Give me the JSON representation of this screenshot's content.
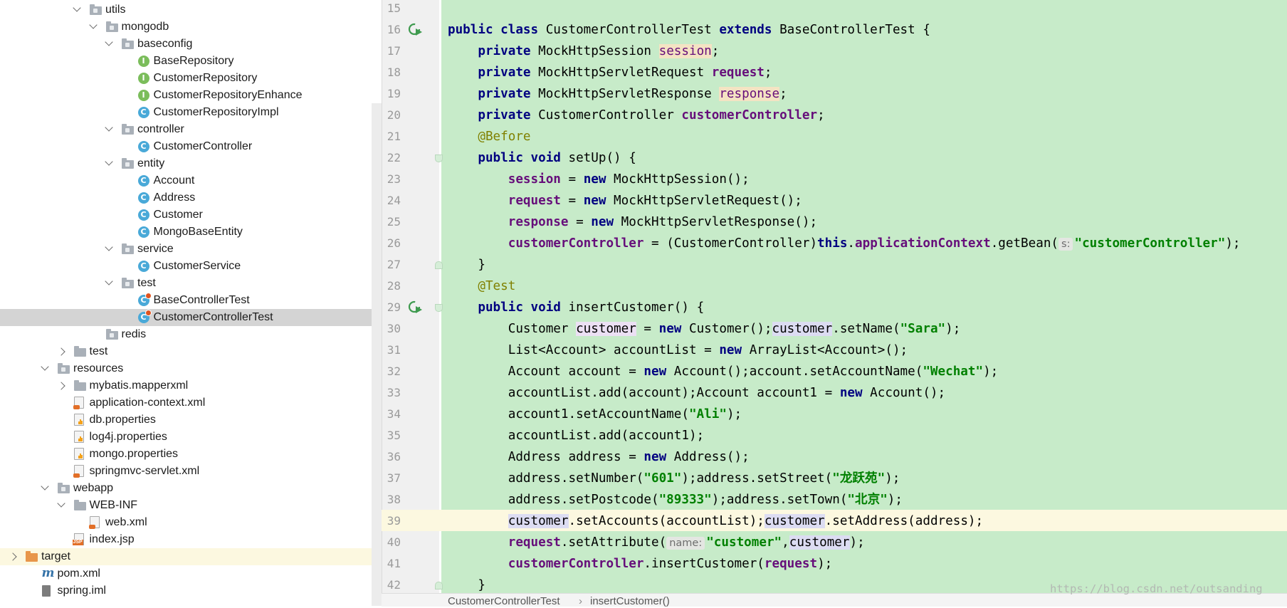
{
  "project_tree": {
    "items": [
      {
        "label": "utils",
        "icon": "folder-dot-icon",
        "chevron": "down",
        "depth": 4
      },
      {
        "label": "mongodb",
        "icon": "folder-dot-icon",
        "chevron": "down",
        "depth": 5
      },
      {
        "label": "baseconfig",
        "icon": "folder-dot-icon",
        "chevron": "down",
        "depth": 6
      },
      {
        "label": "BaseRepository",
        "icon": "interface-icon",
        "chevron": "none",
        "depth": 7
      },
      {
        "label": "CustomerRepository",
        "icon": "interface-icon",
        "chevron": "none",
        "depth": 7
      },
      {
        "label": "CustomerRepositoryEnhance",
        "icon": "interface-icon",
        "chevron": "none",
        "depth": 7
      },
      {
        "label": "CustomerRepositoryImpl",
        "icon": "class-icon",
        "chevron": "none",
        "depth": 7
      },
      {
        "label": "controller",
        "icon": "folder-dot-icon",
        "chevron": "down",
        "depth": 6
      },
      {
        "label": "CustomerController",
        "icon": "class-icon",
        "chevron": "none",
        "depth": 7
      },
      {
        "label": "entity",
        "icon": "folder-dot-icon",
        "chevron": "down",
        "depth": 6
      },
      {
        "label": "Account",
        "icon": "class-icon",
        "chevron": "none",
        "depth": 7
      },
      {
        "label": "Address",
        "icon": "class-icon",
        "chevron": "none",
        "depth": 7
      },
      {
        "label": "Customer",
        "icon": "class-icon",
        "chevron": "none",
        "depth": 7
      },
      {
        "label": "MongoBaseEntity",
        "icon": "class-icon",
        "chevron": "none",
        "depth": 7
      },
      {
        "label": "service",
        "icon": "folder-dot-icon",
        "chevron": "down",
        "depth": 6
      },
      {
        "label": "CustomerService",
        "icon": "class-icon",
        "chevron": "none",
        "depth": 7
      },
      {
        "label": "test",
        "icon": "folder-dot-icon",
        "chevron": "down",
        "depth": 6
      },
      {
        "label": "BaseControllerTest",
        "icon": "test-class-icon",
        "chevron": "none",
        "depth": 7
      },
      {
        "label": "CustomerControllerTest",
        "icon": "test-class-icon",
        "chevron": "none",
        "depth": 7,
        "selected": true
      },
      {
        "label": "redis",
        "icon": "folder-dot-icon",
        "chevron": "none",
        "depth": 5
      },
      {
        "label": "test",
        "icon": "folder-icon",
        "chevron": "right",
        "depth": 3
      },
      {
        "label": "resources",
        "icon": "resources-folder-icon",
        "chevron": "down",
        "depth": 2
      },
      {
        "label": "mybatis.mapperxml",
        "icon": "folder-icon",
        "chevron": "right",
        "depth": 3
      },
      {
        "label": "application-context.xml",
        "icon": "spring-xml-icon",
        "chevron": "none",
        "depth": 3
      },
      {
        "label": "db.properties",
        "icon": "properties-icon",
        "chevron": "none",
        "depth": 3
      },
      {
        "label": "log4j.properties",
        "icon": "properties-icon",
        "chevron": "none",
        "depth": 3
      },
      {
        "label": "mongo.properties",
        "icon": "properties-icon",
        "chevron": "none",
        "depth": 3
      },
      {
        "label": "springmvc-servlet.xml",
        "icon": "spring-xml-icon",
        "chevron": "none",
        "depth": 3
      },
      {
        "label": "webapp",
        "icon": "web-folder-icon",
        "chevron": "down",
        "depth": 2
      },
      {
        "label": "WEB-INF",
        "icon": "folder-icon",
        "chevron": "down",
        "depth": 3
      },
      {
        "label": "web.xml",
        "icon": "web-xml-icon",
        "chevron": "none",
        "depth": 4
      },
      {
        "label": "index.jsp",
        "icon": "jsp-icon",
        "chevron": "none",
        "depth": 3
      },
      {
        "label": "target",
        "icon": "excluded-folder-icon",
        "chevron": "right",
        "depth": 0,
        "highlight": true
      },
      {
        "label": "pom.xml",
        "icon": "maven-icon",
        "chevron": "none",
        "depth": 1
      },
      {
        "label": "spring.iml",
        "icon": "iml-icon",
        "chevron": "none",
        "depth": 1
      }
    ]
  },
  "editor": {
    "lines": [
      {
        "num": "15",
        "html": ""
      },
      {
        "num": "16",
        "run": true,
        "html": "<span class='kw'>public class</span> CustomerControllerTest <span class='kw'>extends</span> BaseControllerTest {"
      },
      {
        "num": "17",
        "html": "    <span class='kw'>private</span> MockHttpSession <span class='fld hl-write' style='font-weight:normal;color:#660e7a'>session</span>;"
      },
      {
        "num": "18",
        "html": "    <span class='kw'>private</span> MockHttpServletRequest <span class='fld'>request</span>;"
      },
      {
        "num": "19",
        "html": "    <span class='kw'>private</span> MockHttpServletResponse <span class='fld hl-write' style='font-weight:normal;color:#660e7a'>response</span>;"
      },
      {
        "num": "20",
        "html": "    <span class='kw'>private</span> CustomerController <span class='fld'>customerController</span>;"
      },
      {
        "num": "21",
        "html": "    <span class='ann'>@Before</span>"
      },
      {
        "num": "22",
        "fold": "open",
        "html": "    <span class='kw'>public void</span> setUp() {"
      },
      {
        "num": "23",
        "html": "        <span class='fld'>session</span> = <span class='kw'>new</span> MockHttpSession();"
      },
      {
        "num": "24",
        "html": "        <span class='fld'>request</span> = <span class='kw'>new</span> MockHttpServletRequest();"
      },
      {
        "num": "25",
        "html": "        <span class='fld'>response</span> = <span class='kw'>new</span> MockHttpServletResponse();"
      },
      {
        "num": "26",
        "html": "        <span class='fld'>customerController</span> = (CustomerController)<span class='kw'>this</span>.<span class='fld'>applicationContext</span>.getBean(<span class='hint'>s:</span><span class='str'>\"customerController\"</span>);"
      },
      {
        "num": "27",
        "fold": "close",
        "html": "    }"
      },
      {
        "num": "28",
        "html": "    <span class='ann'>@Test</span>"
      },
      {
        "num": "29",
        "run": true,
        "fold": "open",
        "html": "    <span class='kw'>public void</span> insertCustomer() {"
      },
      {
        "num": "30",
        "html": "        Customer <span class='hl-sel'>customer</span> = <span class='kw'>new</span> Customer();<span class='hl-ref'>customer</span>.setName(<span class='str'>\"Sara\"</span>);"
      },
      {
        "num": "31",
        "html": "        List&lt;Account&gt; accountList = <span class='kw'>new</span> ArrayList&lt;Account&gt;();"
      },
      {
        "num": "32",
        "html": "        Account account = <span class='kw'>new</span> Account();account.setAccountName(<span class='str'>\"Wechat\"</span>);"
      },
      {
        "num": "33",
        "html": "        accountList.add(account);Account account1 = <span class='kw'>new</span> Account();"
      },
      {
        "num": "34",
        "html": "        account1.setAccountName(<span class='str'>\"Ali\"</span>);"
      },
      {
        "num": "35",
        "html": "        accountList.add(account1);"
      },
      {
        "num": "36",
        "html": "        Address address = <span class='kw'>new</span> Address();"
      },
      {
        "num": "37",
        "html": "        address.setNumber(<span class='str'>\"601\"</span>);address.setStreet(<span class='str'>\"龙跃苑\"</span>);"
      },
      {
        "num": "38",
        "html": "        address.setPostcode(<span class='str'>\"89333\"</span>);address.setTown(<span class='str'>\"北京\"</span>);"
      },
      {
        "num": "39",
        "current": true,
        "html": "        <span class='hl-ref'>customer</span>.setAccounts(accountList);<span class='hl-ref'>customer</span>.setAddress(address);"
      },
      {
        "num": "40",
        "html": "        <span class='fld'>request</span>.setAttribute(<span class='hint'>name:</span><span class='str'>\"customer\"</span>,<span class='hl-ref'>customer</span>);"
      },
      {
        "num": "41",
        "html": "        <span class='fld'>customerController</span>.insertCustomer(<span class='fld'>request</span>);"
      },
      {
        "num": "42",
        "fold": "close",
        "html": "    }"
      }
    ]
  },
  "breadcrumb": {
    "class_name": "CustomerControllerTest",
    "separator": "›",
    "method_name": "insertCustomer()"
  },
  "watermark": "https://blog.csdn.net/outsanding",
  "colors": {
    "code_background": "#c7ebc9",
    "keyword": "#000080",
    "field": "#660e7a",
    "string": "#008000",
    "annotation": "#808000",
    "selection_row": "#d4d4d4"
  }
}
